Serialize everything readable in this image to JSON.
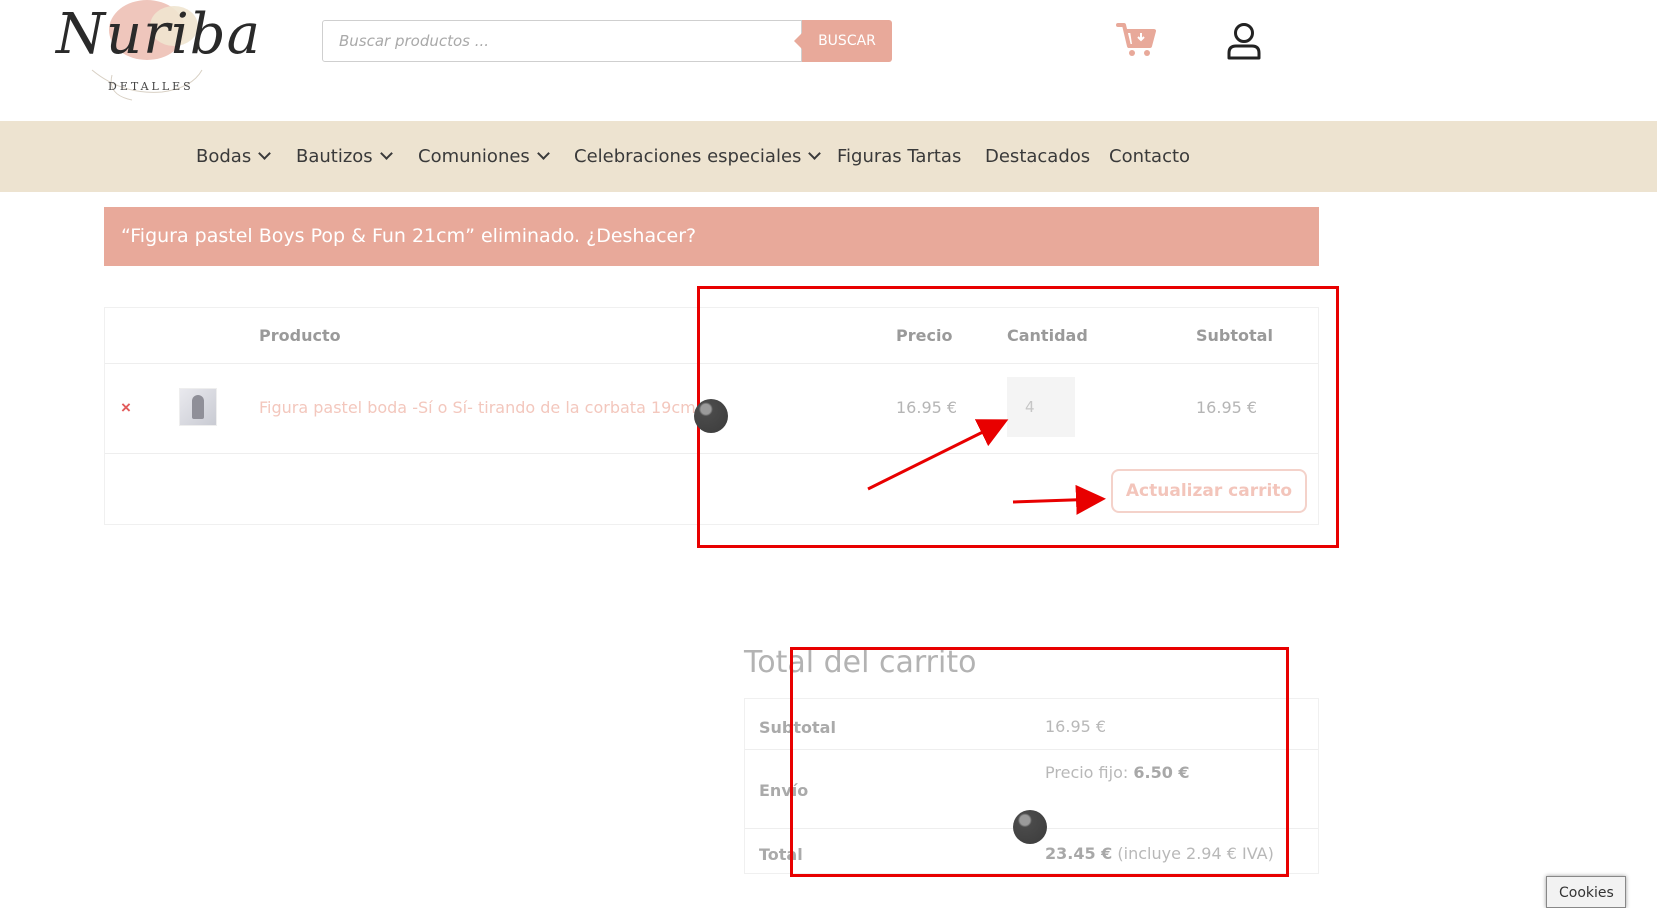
{
  "header": {
    "logo_script": "Nuriba",
    "logo_sub": "DETALLES",
    "search": {
      "placeholder": "Buscar productos ...",
      "button": "BUSCAR"
    }
  },
  "nav": {
    "items": [
      {
        "label": "Bodas",
        "dropdown": true
      },
      {
        "label": "Bautizos",
        "dropdown": true
      },
      {
        "label": "Comuniones",
        "dropdown": true
      },
      {
        "label": "Celebraciones especiales",
        "dropdown": true
      },
      {
        "label": "Figuras Tartas",
        "dropdown": false
      },
      {
        "label": "Destacados",
        "dropdown": false
      },
      {
        "label": "Contacto",
        "dropdown": false
      }
    ]
  },
  "notice": {
    "text": "“Figura pastel Boys Pop & Fun 21cm” eliminado. ¿Deshacer?"
  },
  "cart": {
    "headers": {
      "product": "Producto",
      "price": "Precio",
      "quantity": "Cantidad",
      "subtotal": "Subtotal"
    },
    "row": {
      "remove": "×",
      "name": "Figura pastel boda -Sí o Sí- tirando de la corbata 19cm.",
      "price": "16.95 €",
      "quantity": "4",
      "subtotal": "16.95 €"
    },
    "update_button": "Actualizar carrito"
  },
  "totals": {
    "title": "Total del carrito",
    "subtotal_label": "Subtotal",
    "subtotal_value": "16.95 €",
    "shipping_label": "Envío",
    "shipping_prefix": "Precio fijo:",
    "shipping_value": "6.50 €",
    "total_label": "Total",
    "total_value": "23.45 €",
    "total_note": "(incluye 2.94 € IVA)"
  },
  "cookies": {
    "label": "Cookies"
  },
  "colors": {
    "accent": "#e8a99a",
    "nav_bg": "#ede3d0",
    "annotation": "#e80000"
  }
}
